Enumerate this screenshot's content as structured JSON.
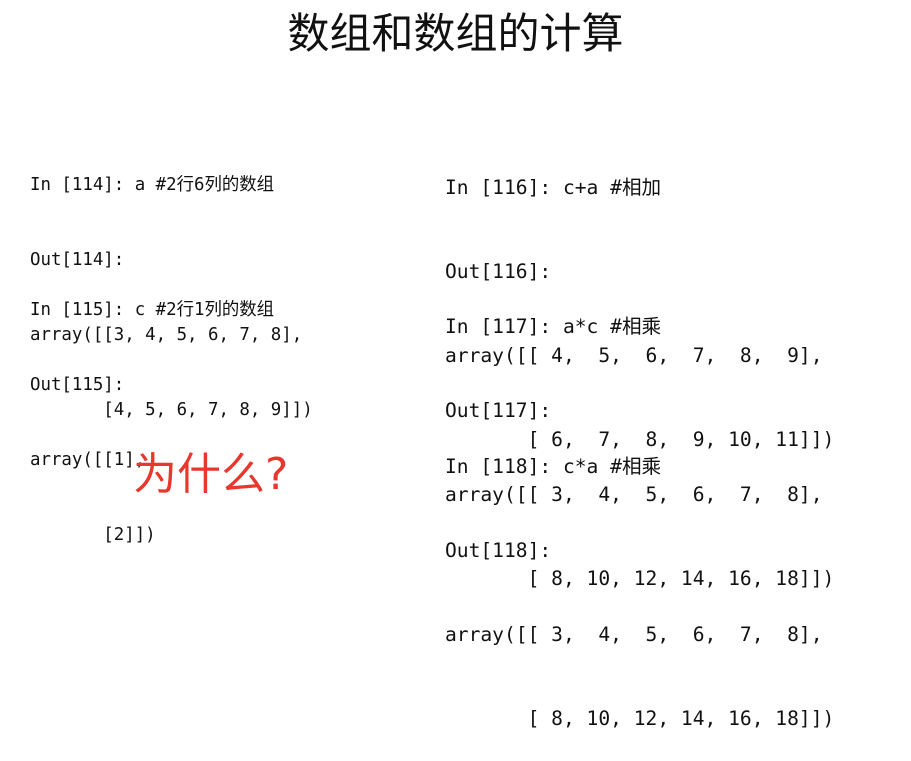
{
  "title": "数组和数组的计算",
  "left_blocks": [
    {
      "lines": [
        "In [114]: a #2行6列的数组",
        "Out[114]:",
        "array([[3, 4, 5, 6, 7, 8],",
        "       [4, 5, 6, 7, 8, 9]])"
      ]
    },
    {
      "lines": [
        "In [115]: c #2行1列的数组",
        "Out[115]:",
        "array([[1],",
        "       [2]])"
      ]
    }
  ],
  "right_blocks": [
    {
      "lines": [
        "In [116]: c+a #相加",
        "Out[116]:",
        "array([[ 4,  5,  6,  7,  8,  9],",
        "       [ 6,  7,  8,  9, 10, 11]])"
      ]
    },
    {
      "lines": [
        "In [117]: a*c #相乘",
        "Out[117]:",
        "array([[ 3,  4,  5,  6,  7,  8],",
        "       [ 8, 10, 12, 14, 16, 18]])"
      ]
    },
    {
      "lines": [
        "In [118]: c*a #相乘",
        "Out[118]:",
        "array([[ 3,  4,  5,  6,  7,  8],",
        "       [ 8, 10, 12, 14, 16, 18]])"
      ]
    }
  ],
  "question": "为什么?",
  "colors": {
    "text": "#111111",
    "question": "#e8372c",
    "background": "#ffffff"
  }
}
